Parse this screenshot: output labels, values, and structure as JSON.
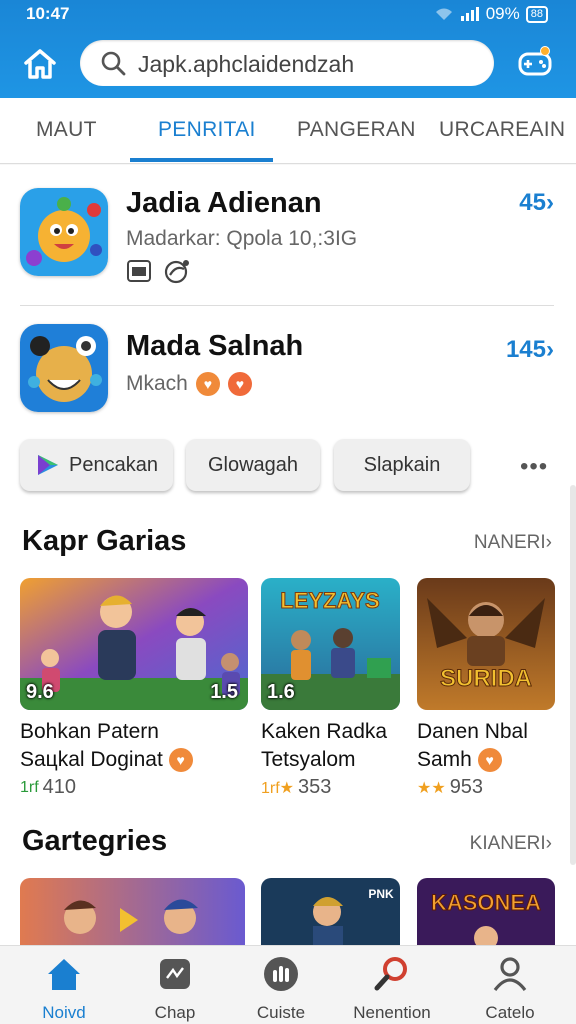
{
  "status_bar": {
    "time": "10:47",
    "battery_text": "09%",
    "battery_icon_text": "88"
  },
  "header": {
    "search": {
      "value": "Japk.aphclaidendzah"
    }
  },
  "tabs": [
    {
      "label": "MAUT",
      "active": false
    },
    {
      "label": "PENRITAI",
      "active": true
    },
    {
      "label": "PANGERAN",
      "active": false
    },
    {
      "label": "URCAREAIN",
      "active": false
    }
  ],
  "apps": [
    {
      "title": "Jadia Adienan",
      "subtitle": "Madarkar: Qpola 10,:3IG",
      "rank": "45",
      "arrow": "›"
    },
    {
      "title": "Mada Salnah",
      "subtitle": "Mkach",
      "rank": "145",
      "arrow": "›"
    }
  ],
  "chips": [
    {
      "label": "Pencakan"
    },
    {
      "label": "Glowagah"
    },
    {
      "label": "Slapkain"
    }
  ],
  "more_label": "•••",
  "section1": {
    "title": "Kapr Garias",
    "link": "NANERI",
    "link_arrow": "›",
    "cards": [
      {
        "title_line1": "Bohkan Patern",
        "title_line2": "Saцkal Doginat",
        "meta": "410",
        "badge_left": "9.6",
        "badge_right": "1.5",
        "meta_mark": "1rf"
      },
      {
        "title_line1": "Kaken Radka",
        "title_line2": "Tetsyalom",
        "meta": "353",
        "badge_left": "1.6",
        "thumb_text": "LEYZAYS",
        "meta_mark": "1rf★"
      },
      {
        "title_line1": "Danen Nbal",
        "title_line2": "Samh",
        "meta": "953",
        "thumb_text": "SURIDA",
        "meta_mark": "★★"
      }
    ]
  },
  "section2": {
    "title": "Gartegries",
    "link": "KIANERI",
    "link_arrow": "›",
    "thumbs": [
      {
        "text": ""
      },
      {
        "text": "PNK"
      },
      {
        "text": "KASONEA"
      }
    ]
  },
  "bottom_nav": [
    {
      "label": "Noivd",
      "icon": "home-icon",
      "active": true
    },
    {
      "label": "Chap",
      "icon": "chat-icon",
      "active": false
    },
    {
      "label": "Cuiste",
      "icon": "chart-icon",
      "active": false
    },
    {
      "label": "Nenention",
      "icon": "search-magnifier-icon",
      "active": false
    },
    {
      "label": "Catelo",
      "icon": "profile-icon",
      "active": false
    }
  ],
  "colors": {
    "accent": "#1a7fd0",
    "header": "#1f95e4",
    "rank": "#1a7fd0"
  }
}
